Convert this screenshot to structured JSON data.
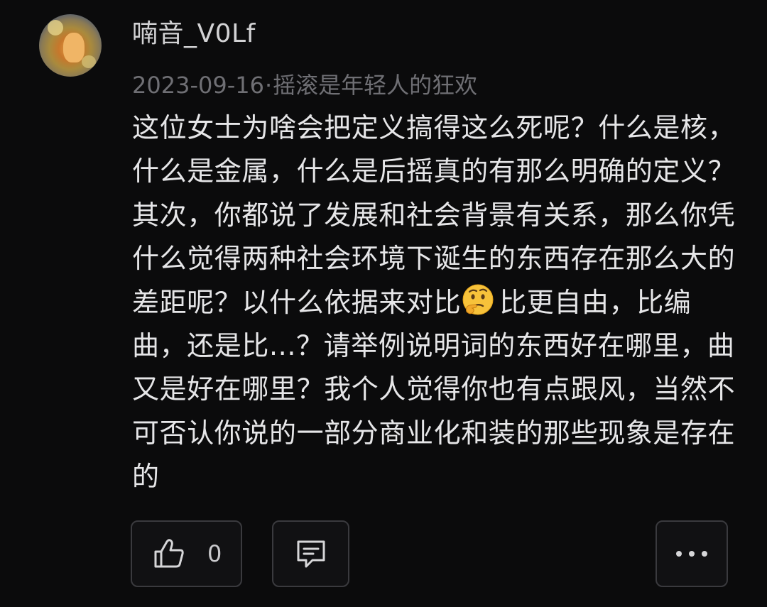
{
  "comment": {
    "username": "喃音_V0Lf",
    "date": "2023-09-16",
    "separator": "·",
    "topic": "摇滚是年轻人的狂欢",
    "text_before_emoji": "这位女士为啥会把定义搞得这么死呢？什么是核，什么是金属，什么是后摇真的有那么明确的定义？其次，你都说了发展和社会背景有关系，那么你凭什么觉得两种社会环境下诞生的东西存在那么大的差距呢？以什么依据来对比",
    "emoji": "thinking-face",
    "text_after_emoji": "比更自由，比编曲，还是比...？请举例说明词的东西好在哪里，曲又是好在哪里？我个人觉得你也有点跟风，当然不可否认你说的一部分商业化和装的那些现象是存在的"
  },
  "actions": {
    "like_icon": "thumbs-up-icon",
    "like_count": "0",
    "reply_icon": "comment-icon",
    "more_icon": "more-dots-icon"
  },
  "colors": {
    "background": "#0b0b0c",
    "text": "#e6e6e8",
    "meta": "#6f6f74",
    "username": "#d2d2d4",
    "button_border": "#3a3a3e"
  }
}
